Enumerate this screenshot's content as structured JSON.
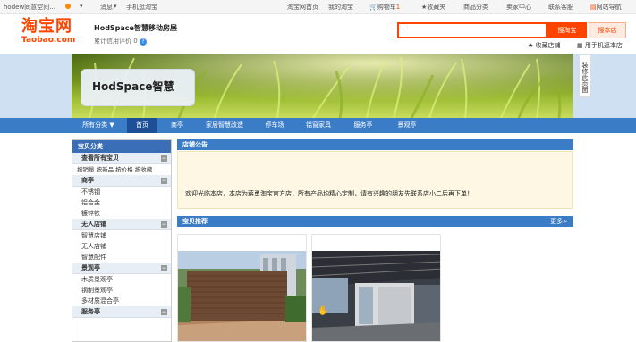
{
  "topbar": {
    "greeting": "hodew同意空间...",
    "messages": "消息",
    "mobile_taobao": "手机逛淘宝",
    "taobao_home": "淘宝网首页",
    "my_taobao": "我的淘宝",
    "cart": "购物车",
    "cart_count": "1",
    "favorites": "收藏夹",
    "categories": "商品分类",
    "seller_center": "卖家中心",
    "contact": "联系客服",
    "site_nav": "网站导航"
  },
  "header": {
    "logo_cn": "淘宝网",
    "logo_en": "Taobao.com",
    "shop_name": "HodSpace智慧移动房屋",
    "credit_label": "累计信用评价",
    "credit_value": "0",
    "search_button": "搜淘宝",
    "search_shop_button": "搜本店",
    "favorite_shop": "收藏店铺",
    "mobile_shop": "用手机逛本店"
  },
  "banner": {
    "shop_title": "HodSpace智慧",
    "fit_page": "装修此页面"
  },
  "nav": {
    "tabs": [
      {
        "label": "所有分类 ▼"
      },
      {
        "label": "首页"
      },
      {
        "label": "商亭"
      },
      {
        "label": "家居智慧改造"
      },
      {
        "label": "停车场"
      },
      {
        "label": "铝窗家具"
      },
      {
        "label": "服务亭"
      },
      {
        "label": "景观亭"
      }
    ]
  },
  "sidebar": {
    "title": "宝贝分类",
    "view_all": "查看所有宝贝",
    "sort_options": "按销量 按新品 按价格 按收藏",
    "groups": [
      {
        "title": "商亭",
        "items": [
          "不锈钢",
          "铝合金",
          "镀锌铁"
        ]
      },
      {
        "title": "无人店铺",
        "items": [
          "智慧店铺",
          "无人店铺",
          "智慧配件"
        ]
      },
      {
        "title": "景观亭",
        "items": [
          "木质景观亭",
          "钢制景观亭",
          "多材质混合亭"
        ]
      },
      {
        "title": "服务亭",
        "items": []
      }
    ]
  },
  "main": {
    "notice_title": "店铺公告",
    "notice_text": "欢迎光临本店，本店为蒋勇淘宝官方店，所有产品均精心定制，请有兴趣的朋友先联系店小二后再下单！",
    "recommend_title": "宝贝推荐",
    "more": "更多>"
  },
  "colors": {
    "accent": "#ff4400",
    "nav_blue": "#3b7cc7",
    "nav_active": "#1c4f96"
  }
}
